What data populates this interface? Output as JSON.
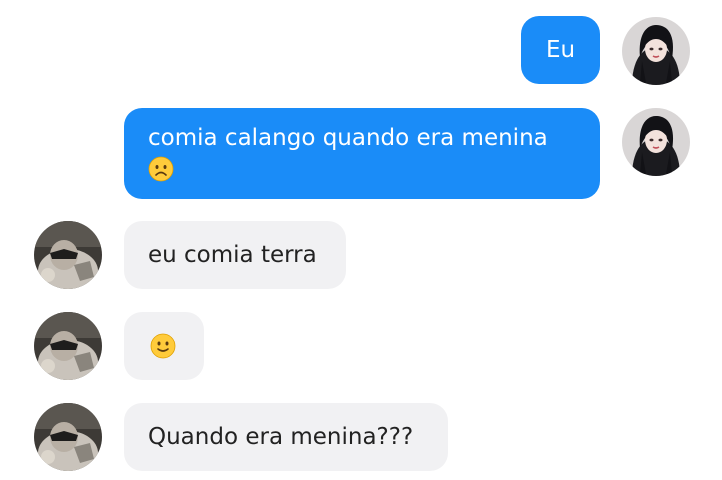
{
  "messages": [
    {
      "sender": "me",
      "text": "Eu",
      "emoji": ""
    },
    {
      "sender": "me",
      "text": "comia calango quando era menina",
      "emoji": "frowning-face-emoji"
    },
    {
      "sender": "other",
      "text": "eu comia terra",
      "emoji": ""
    },
    {
      "sender": "other",
      "text": "",
      "emoji": "slightly-smiling-face-emoji"
    },
    {
      "sender": "other",
      "text": "Quando era menina???",
      "emoji": ""
    }
  ],
  "colors": {
    "outgoing_bubble": "#1a8cf8",
    "incoming_bubble": "#f1f1f3",
    "outgoing_text": "#ffffff",
    "incoming_text": "#222222"
  }
}
